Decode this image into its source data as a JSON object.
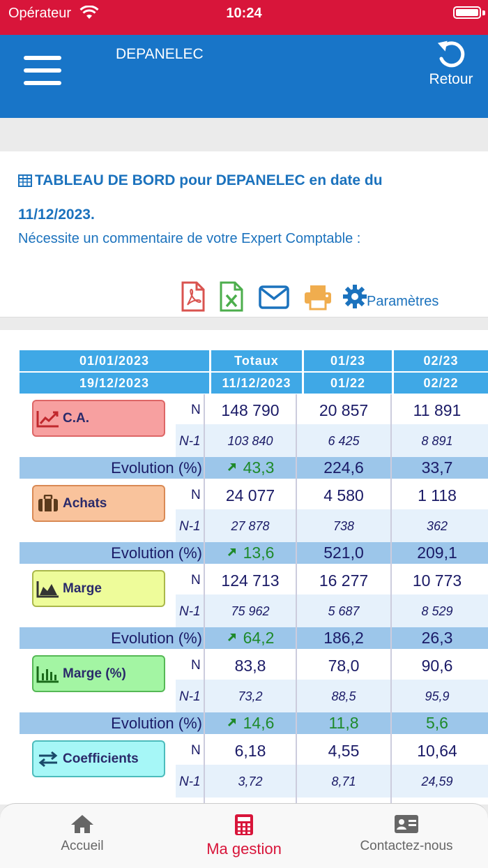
{
  "status_bar": {
    "carrier": "Opérateur",
    "time": "10:24"
  },
  "header": {
    "title": "DEPANELEC",
    "back_label": "Retour"
  },
  "card": {
    "title_line1": "TABLEAU DE BORD pour DEPANELEC en date du",
    "title_line2": "11/12/2023.",
    "subtitle": "Nécessite un commentaire de votre Expert Comptable :",
    "params_label": "Paramètres"
  },
  "table": {
    "header_row1": [
      "01/01/2023",
      "Totaux",
      "01/23",
      "02/23"
    ],
    "header_row2": [
      "19/12/2023",
      "11/12/2023",
      "01/22",
      "02/22"
    ],
    "n_label": "N",
    "n1_label": "N-1",
    "evolution_label": "Evolution (%)",
    "sections": [
      {
        "name": "C.A.",
        "n": [
          "148 790",
          "20 857",
          "11 891"
        ],
        "n1": [
          "103 840",
          "6 425",
          "8 891"
        ],
        "evo": [
          "43,3",
          "224,6",
          "33,7"
        ]
      },
      {
        "name": "Achats",
        "n": [
          "24 077",
          "4 580",
          "1 118"
        ],
        "n1": [
          "27 878",
          "738",
          "362"
        ],
        "evo": [
          "13,6",
          "521,0",
          "209,1"
        ]
      },
      {
        "name": "Marge",
        "n": [
          "124 713",
          "16 277",
          "10 773"
        ],
        "n1": [
          "75 962",
          "5 687",
          "8 529"
        ],
        "evo": [
          "64,2",
          "186,2",
          "26,3"
        ]
      },
      {
        "name": "Marge (%)",
        "n": [
          "83,8",
          "78,0",
          "90,6"
        ],
        "n1": [
          "73,2",
          "88,5",
          "95,9"
        ],
        "evo": [
          "14,6",
          "11,8",
          "5,6"
        ]
      },
      {
        "name": "Coefficients",
        "n": [
          "6,18",
          "4,55",
          "10,64"
        ],
        "n1": [
          "3,72",
          "8,71",
          "24,59"
        ],
        "evo": []
      }
    ]
  },
  "bottom_nav": {
    "items": [
      {
        "label": "Accueil"
      },
      {
        "label": "Ma gestion"
      },
      {
        "label": "Contactez-nous"
      }
    ]
  },
  "colors": {
    "status_bar": "#d8153a",
    "header": "#1875c8",
    "table_header": "#3fa8e6",
    "evolution_row": "#9cc6ea",
    "n1_row": "#e6f1fb",
    "badge_ca": "#f7a0a0",
    "badge_achats": "#f9c39c",
    "badge_marge": "#eefc9a",
    "badge_marge_pct": "#a3f5a3",
    "badge_coef": "#a6f7f7"
  },
  "icons": [
    "wifi-icon",
    "battery-icon",
    "menu-icon",
    "undo-icon",
    "table-icon",
    "pdf-icon",
    "excel-icon",
    "mail-icon",
    "print-icon",
    "gear-icon",
    "chart-line-icon",
    "briefcase-icon",
    "area-chart-icon",
    "bar-chart-icon",
    "exchange-icon",
    "trend-up-icon",
    "home-icon",
    "calculator-icon",
    "contact-card-icon"
  ]
}
